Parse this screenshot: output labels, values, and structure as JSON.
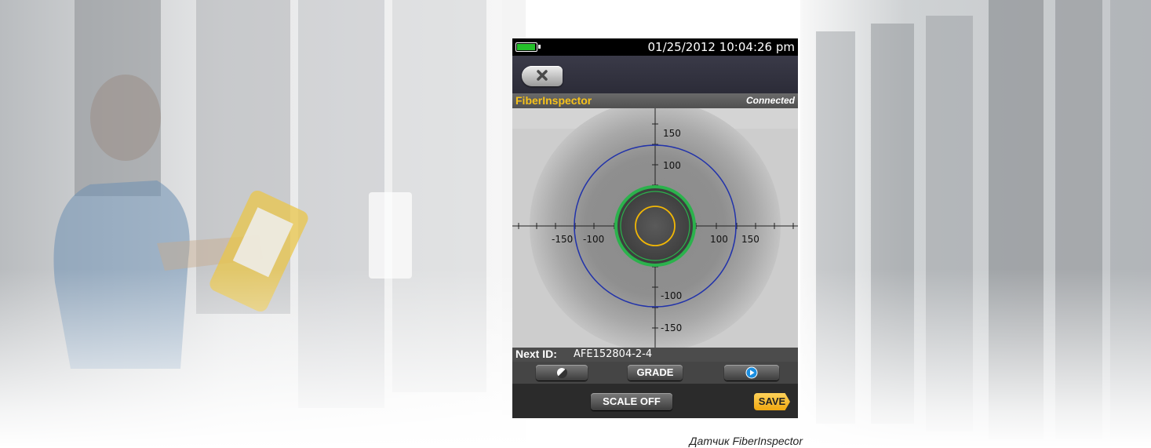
{
  "device": {
    "status_bar": {
      "datetime": "01/25/2012 10:04:26 pm",
      "battery_icon": "battery-full-icon",
      "battery_color": "#24c02a"
    },
    "nav": {
      "close_icon": "close-x-icon"
    },
    "header": {
      "title": "FiberInspector",
      "status": "Connected",
      "title_color": "#f7c21a"
    },
    "scope": {
      "x_tick_labels": [
        "-150",
        "-100",
        "100",
        "150"
      ],
      "y_tick_labels": [
        "150",
        "100",
        "-100",
        "-150"
      ],
      "zone_colors": {
        "outer": "#2233aa",
        "cladding": "#2bb24c",
        "core": "#f2b705"
      }
    },
    "next_id": {
      "label": "Next ID:",
      "value": "AFE152804-2-4"
    },
    "tools": {
      "contrast_icon": "contrast-icon",
      "grade_label": "GRADE",
      "play_icon": "play-icon"
    },
    "bottom": {
      "scale_label": "SCALE OFF",
      "save_label": "SAVE",
      "save_color": "#f5b82a"
    }
  },
  "caption": "Датчик FiberInspector"
}
